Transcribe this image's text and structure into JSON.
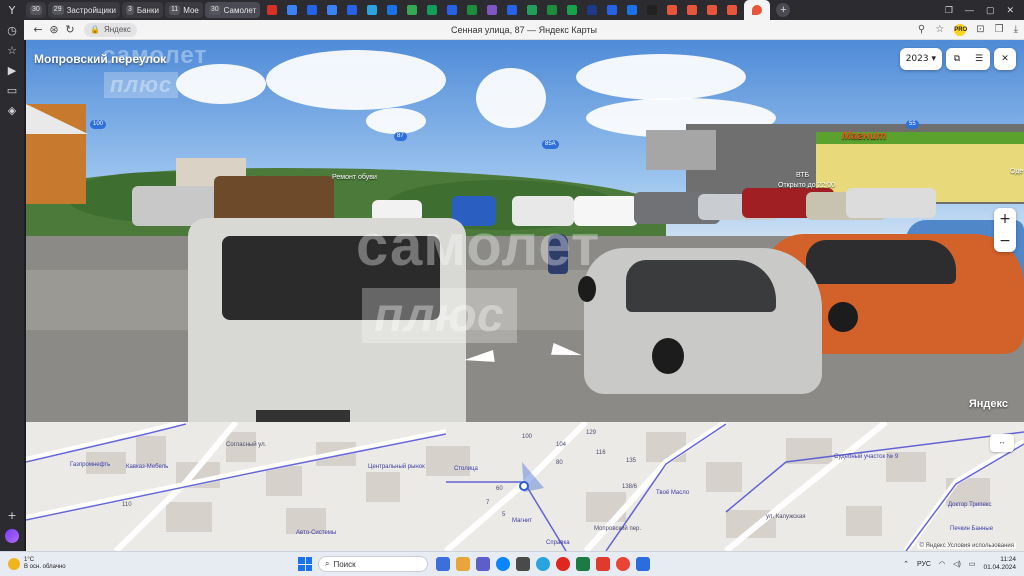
{
  "sidebar": {
    "icons": [
      "yandex-browser-icon",
      "clock-icon",
      "bookmarks-icon",
      "play-icon",
      "tv-icon",
      "screenshot-icon",
      "add-icon",
      "alice-icon"
    ]
  },
  "tabs": {
    "groups": [
      {
        "count": "30",
        "label": ""
      },
      {
        "count": "29",
        "label": "Застройщики"
      },
      {
        "count": "3",
        "label": "Банки"
      },
      {
        "count": "11",
        "label": "Мое"
      },
      {
        "count": "30",
        "label": "Самолет"
      }
    ],
    "mini_tab_colors": [
      "#d93025",
      "#3b82f6",
      "#2563eb",
      "#3b82f6",
      "#2563eb",
      "#2aa3e0",
      "#1a73e8",
      "#34a853",
      "#0f9d58",
      "#2563eb",
      "#1e8e3e",
      "#7e57c2",
      "#2563eb",
      "#22a05b",
      "#1e8e3e",
      "#16a34a",
      "#1e3a8a",
      "#2563eb",
      "#1a73e8",
      "#222222",
      "#e8553b",
      "#e8553b",
      "#e8553b",
      "#e8553b"
    ],
    "new_tab": "+"
  },
  "address": {
    "site": "Яндекс",
    "title": "Сенная улица, 87 — Яндекс Карты"
  },
  "pano": {
    "street": "Мопровский переулок",
    "year": "2023",
    "watermark_top": "самолет",
    "watermark_bottom": "плюс",
    "zoom_in": "+",
    "zoom_out": "−",
    "logo": "Яндекс",
    "poi": {
      "shoe": "Ремонт обуви",
      "vtb": "ВТБ",
      "hours": "Открыто до 22:00",
      "store": "Магнит",
      "odezhda": "Оде"
    },
    "bus_labels": [
      "100",
      "87",
      "85А",
      "55"
    ]
  },
  "map": {
    "labels": {
      "soglasnyy": "Согласный ул.",
      "gazprom": "Газпромнефть",
      "kavkaz": "Кавказ-Мебель",
      "house110": "110",
      "fond": "Авто-Системы",
      "centr": "Центральный рынок",
      "stolica": "Столица",
      "magnit": "Магнит",
      "spravka": "Справка",
      "sud": "Судебный участок № 9",
      "doktor": "Доктор Трипекс",
      "pechki": "Печкин Банные",
      "kaluzh": "ул. Калужская",
      "maslo": "Твоё Масло",
      "moprov": "Мопровский пер.",
      "n100": "100",
      "n104": "104",
      "n116": "116",
      "n80": "80",
      "n129": "129",
      "n60": "60",
      "n135": "135",
      "n138": "138/6",
      "n7": "7",
      "n5": "5"
    },
    "ctrl": "↔",
    "copyright": "© Яндекс  Условия использования"
  },
  "taskbar": {
    "temp": "1°C",
    "weather": "В осн. облачно",
    "search": "Поиск",
    "lang": "РУС",
    "time": "11:24",
    "date": "01.04.2024"
  }
}
